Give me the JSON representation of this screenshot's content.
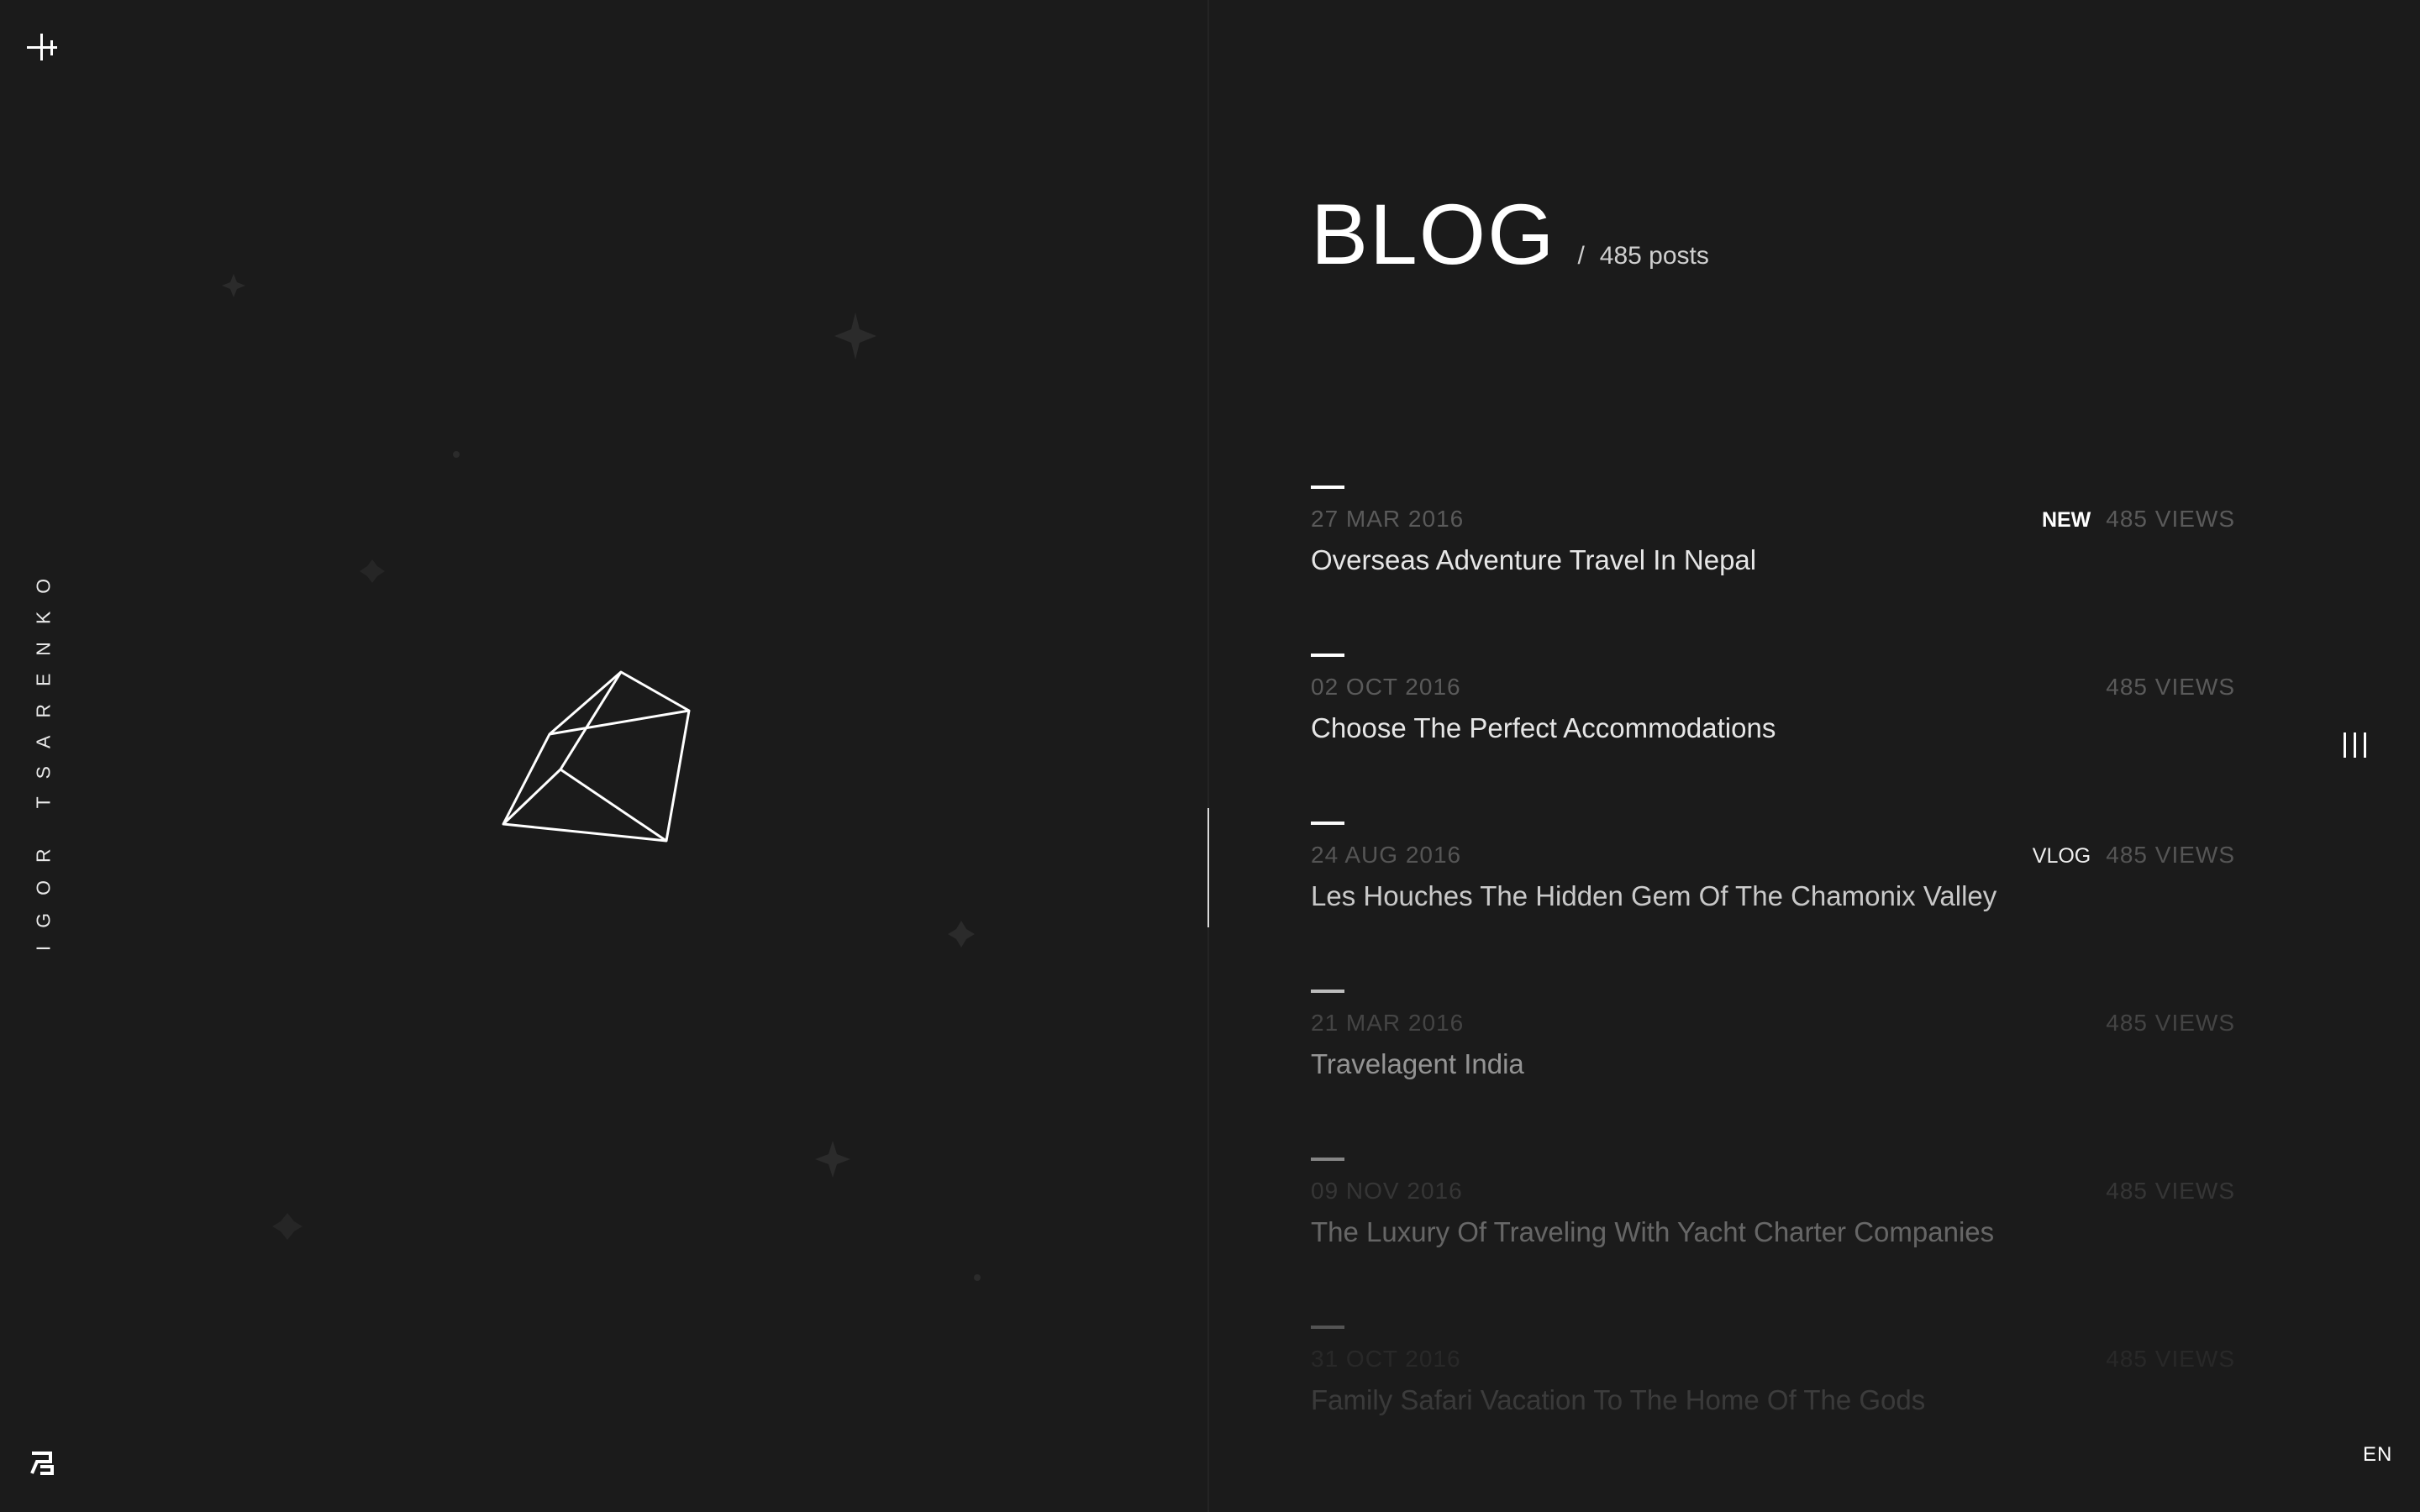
{
  "sidebar": {
    "name": "IGOR TSARENKO",
    "language": "EN"
  },
  "icons": {
    "top_left": "plus-icon",
    "bottom_left": "logo-mark-icon",
    "right_menu": "menu-bars-icon",
    "hero": "polyhedron-icon"
  },
  "blog": {
    "title": "BLOG",
    "separator": "/",
    "count_label": "485 posts"
  },
  "posts": [
    {
      "date": "27 MAR 2016",
      "tag": "NEW",
      "views": "485 VIEWS",
      "title": "Overseas Adventure Travel In Nepal"
    },
    {
      "date": "02 OCT 2016",
      "tag": "",
      "views": "485 VIEWS",
      "title": "Choose The Perfect Accommodations"
    },
    {
      "date": "24 AUG 2016",
      "tag": "VLOG",
      "views": "485 VIEWS",
      "title": "Les Houches The Hidden Gem Of The Chamonix Valley"
    },
    {
      "date": "21 MAR 2016",
      "tag": "",
      "views": "485 VIEWS",
      "title": "Travelagent India"
    },
    {
      "date": "09 NOV 2016",
      "tag": "",
      "views": "485 VIEWS",
      "title": "The Luxury Of Traveling With Yacht Charter Companies"
    },
    {
      "date": "31 OCT 2016",
      "tag": "",
      "views": "485 VIEWS",
      "title": "Family Safari Vacation To The Home Of The Gods"
    }
  ],
  "colors": {
    "background": "#1b1b1b",
    "text": "#ffffff",
    "muted": "#5a5a5a"
  }
}
